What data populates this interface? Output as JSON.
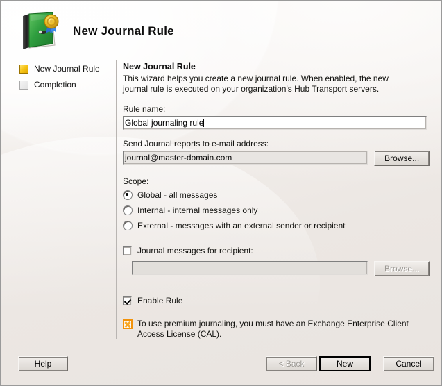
{
  "window": {
    "title": "New Journal Rule",
    "icon": "green-journal-book-with-gold-medal"
  },
  "sidebar": {
    "steps": [
      {
        "label": "New Journal Rule",
        "state": "active",
        "icon": "step-active-square-icon"
      },
      {
        "label": "Completion",
        "state": "inactive",
        "icon": "step-inactive-square-icon"
      }
    ]
  },
  "main": {
    "pane_title": "New Journal Rule",
    "description": "This wizard helps you create a new journal rule. When enabled, the new journal rule is executed on your organization's Hub Transport servers.",
    "rule_name": {
      "label": "Rule name:",
      "value": "Global journaling rule"
    },
    "journal_email": {
      "label": "Send Journal reports to e-mail address:",
      "value": "journal@master-domain.com",
      "browse_label": "Browse...",
      "readonly": true
    },
    "scope": {
      "label": "Scope:",
      "options": [
        {
          "label": "Global - all messages",
          "selected": true
        },
        {
          "label": "Internal - internal messages only",
          "selected": false
        },
        {
          "label": "External - messages with an external sender or recipient",
          "selected": false
        }
      ]
    },
    "journal_recipient": {
      "label": "Journal messages for recipient:",
      "checked": false,
      "value": "",
      "browse_label": "Browse...",
      "browse_enabled": false
    },
    "enable_rule": {
      "label": "Enable Rule",
      "checked": true
    },
    "warning": {
      "icon": "warning-license-icon",
      "text": "To use premium journaling, you must have an Exchange Enterprise Client Access License (CAL).",
      "color": "#f2920a"
    }
  },
  "footer": {
    "help_label": "Help",
    "back_label": "< Back",
    "back_enabled": false,
    "new_label": "New",
    "new_is_default": true,
    "cancel_label": "Cancel"
  }
}
